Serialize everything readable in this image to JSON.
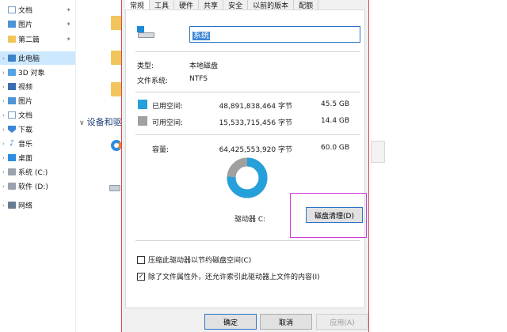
{
  "nav": {
    "items": [
      {
        "label": "文档",
        "icon": "doc-icon",
        "pinned": true
      },
      {
        "label": "图片",
        "icon": "pictures-icon",
        "pinned": true
      },
      {
        "label": "第二篇",
        "icon": "folder-icon",
        "pinned": true
      },
      {
        "label": "此电脑",
        "icon": "computer-icon",
        "selected": true
      },
      {
        "label": "3D 对象",
        "icon": "3d-objects-icon"
      },
      {
        "label": "视频",
        "icon": "videos-icon"
      },
      {
        "label": "图片",
        "icon": "pictures-icon"
      },
      {
        "label": "文档",
        "icon": "doc-icon"
      },
      {
        "label": "下载",
        "icon": "download-icon"
      },
      {
        "label": "音乐",
        "icon": "music-icon"
      },
      {
        "label": "桌面",
        "icon": "desktop-icon"
      },
      {
        "label": "系统 (C:)",
        "icon": "drive-icon"
      },
      {
        "label": "软件 (D:)",
        "icon": "drive-icon"
      },
      {
        "label": "网络",
        "icon": "network-icon"
      }
    ]
  },
  "content": {
    "section_header": "设备和驱动器"
  },
  "dialog": {
    "tabs": [
      "常规",
      "工具",
      "硬件",
      "共享",
      "安全",
      "以前的版本",
      "配额"
    ],
    "active_tab": "常规",
    "drive_name": "系统",
    "type_label": "类型:",
    "type_value": "本地磁盘",
    "fs_label": "文件系统:",
    "fs_value": "NTFS",
    "used": {
      "label": "已用空间:",
      "bytes": "48,891,838,464 字节",
      "size": "45.5 GB",
      "color": "#26a0da"
    },
    "free": {
      "label": "可用空间:",
      "bytes": "15,533,715,456 字节",
      "size": "14.4 GB",
      "color": "#a0a0a0"
    },
    "capacity": {
      "label": "容量:",
      "bytes": "64,425,553,920 字节",
      "size": "60.0 GB"
    },
    "drive_label": "驱动器 C:",
    "cleanup_button": "磁盘清理(D)",
    "compress_label": "压缩此驱动器以节约磁盘空间(C)",
    "compress_checked": false,
    "index_label": "除了文件属性外，还允许索引此驱动器上文件的内容(I)",
    "index_checked": true,
    "ok_button": "确定",
    "cancel_button": "取消",
    "apply_button": "应用(A)",
    "used_fraction": 0.759
  }
}
